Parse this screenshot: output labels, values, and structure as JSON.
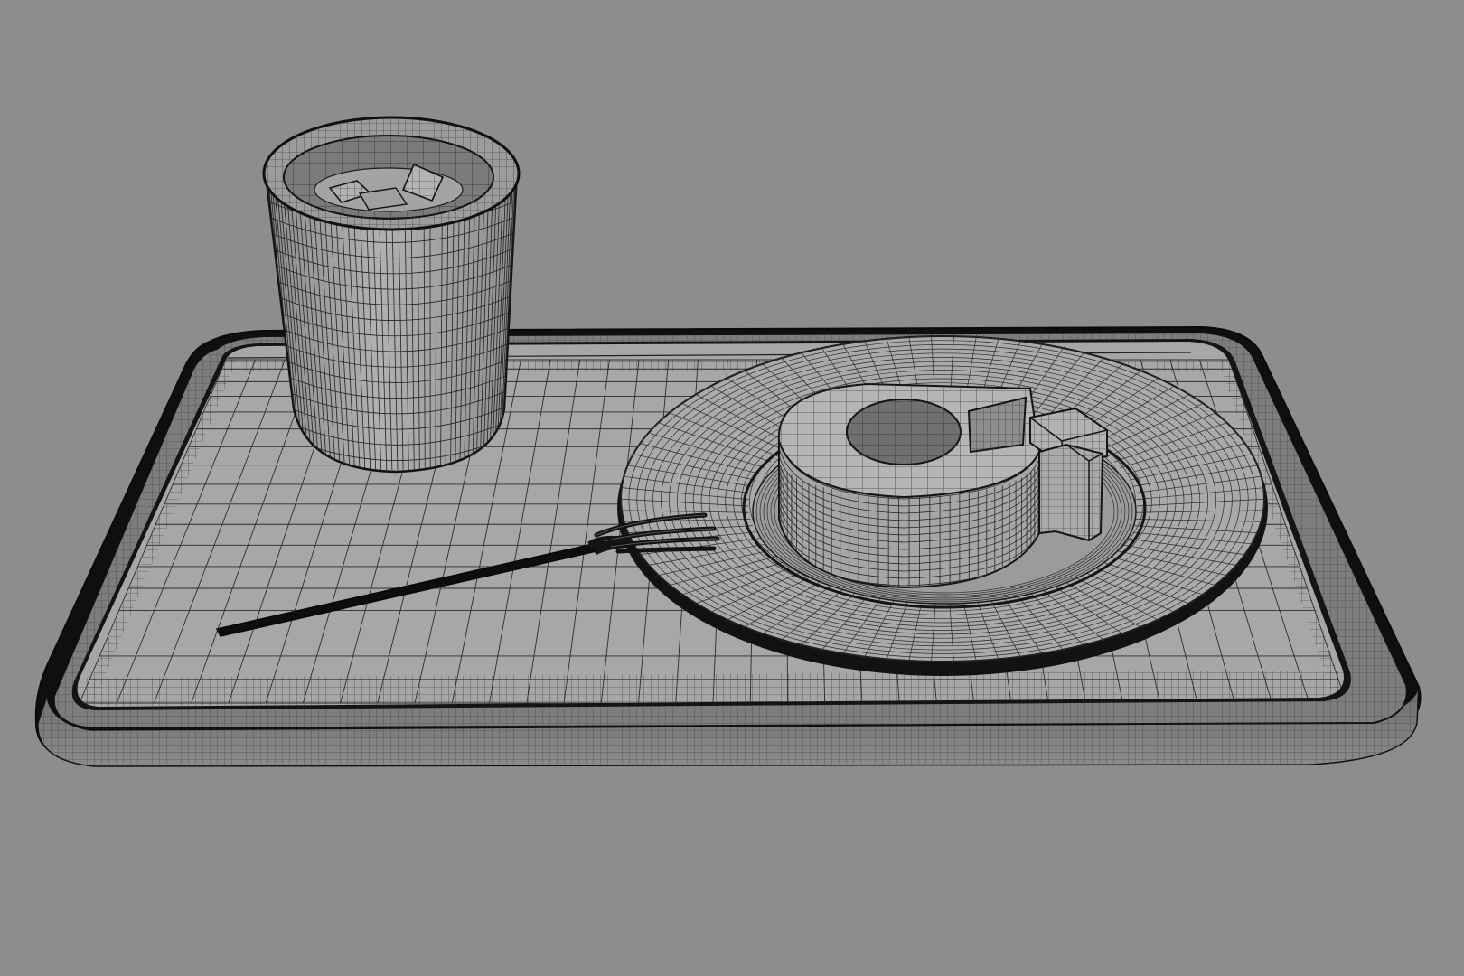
{
  "scene": {
    "render_style": "wireframe",
    "objects": [
      {
        "name": "tray"
      },
      {
        "name": "cup",
        "contents": "ice cubes"
      },
      {
        "name": "plate"
      },
      {
        "name": "ring-cake",
        "slices": 2
      },
      {
        "name": "fork"
      }
    ]
  },
  "colors": {
    "background": "#8c8d8f",
    "surface": "#a3a4a6",
    "surface_light": "#b4b5b7",
    "surface_dark": "#7d7e80",
    "wire": "#202020",
    "outline": "#0c0c0c"
  }
}
